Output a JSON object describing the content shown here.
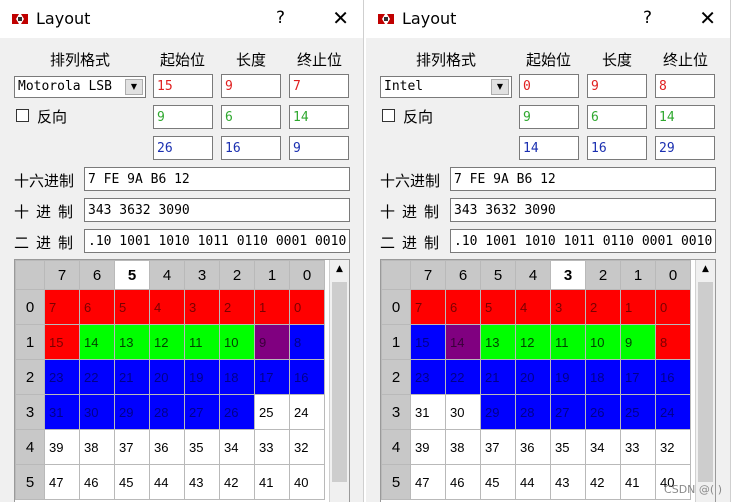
{
  "windows": [
    {
      "title": "Layout",
      "help": "?",
      "close": "✕",
      "headers": {
        "format": "排列格式",
        "start": "起始位",
        "length": "长度",
        "end": "终止位"
      },
      "format_value": "Motorola LSB",
      "reverse_label": "反向",
      "rows": [
        {
          "start": "15",
          "length": "9",
          "end": "7",
          "color": "red"
        },
        {
          "start": "9",
          "length": "6",
          "end": "14",
          "color": "green"
        },
        {
          "start": "26",
          "length": "16",
          "end": "9",
          "color": "blue"
        }
      ],
      "hex_label": "十六进制",
      "hex_value": "7 FE 9A B6 12",
      "dec_label": "十进制",
      "dec_value": "343 3632 3090",
      "bin_label": "二进制",
      "bin_value": ".10 1001 1010 1011 0110 0001 0010",
      "grid": {
        "col_headers": [
          "7",
          "6",
          "5",
          "4",
          "3",
          "2",
          "1",
          "0"
        ],
        "current_col": 2,
        "rows": [
          {
            "label": "0",
            "cells": [
              {
                "v": "7",
                "c": "r"
              },
              {
                "v": "6",
                "c": "r"
              },
              {
                "v": "5",
                "c": "r"
              },
              {
                "v": "4",
                "c": "r"
              },
              {
                "v": "3",
                "c": "r"
              },
              {
                "v": "2",
                "c": "r"
              },
              {
                "v": "1",
                "c": "r"
              },
              {
                "v": "0",
                "c": "r"
              }
            ]
          },
          {
            "label": "1",
            "cells": [
              {
                "v": "15",
                "c": "r"
              },
              {
                "v": "14",
                "c": "g"
              },
              {
                "v": "13",
                "c": "g"
              },
              {
                "v": "12",
                "c": "g"
              },
              {
                "v": "11",
                "c": "g"
              },
              {
                "v": "10",
                "c": "g"
              },
              {
                "v": "9",
                "c": "p"
              },
              {
                "v": "8",
                "c": "b"
              }
            ]
          },
          {
            "label": "2",
            "cells": [
              {
                "v": "23",
                "c": "b"
              },
              {
                "v": "22",
                "c": "b"
              },
              {
                "v": "21",
                "c": "b"
              },
              {
                "v": "20",
                "c": "b"
              },
              {
                "v": "19",
                "c": "b"
              },
              {
                "v": "18",
                "c": "b"
              },
              {
                "v": "17",
                "c": "b"
              },
              {
                "v": "16",
                "c": "b"
              }
            ]
          },
          {
            "label": "3",
            "cells": [
              {
                "v": "31",
                "c": "b"
              },
              {
                "v": "30",
                "c": "b"
              },
              {
                "v": "29",
                "c": "b"
              },
              {
                "v": "28",
                "c": "b"
              },
              {
                "v": "27",
                "c": "b"
              },
              {
                "v": "26",
                "c": "b"
              },
              {
                "v": "25",
                "c": "w"
              },
              {
                "v": "24",
                "c": "w"
              }
            ]
          },
          {
            "label": "4",
            "cells": [
              {
                "v": "39",
                "c": "w"
              },
              {
                "v": "38",
                "c": "w"
              },
              {
                "v": "37",
                "c": "w"
              },
              {
                "v": "36",
                "c": "w"
              },
              {
                "v": "35",
                "c": "w"
              },
              {
                "v": "34",
                "c": "w"
              },
              {
                "v": "33",
                "c": "w"
              },
              {
                "v": "32",
                "c": "w"
              }
            ]
          },
          {
            "label": "5",
            "cells": [
              {
                "v": "47",
                "c": "w"
              },
              {
                "v": "46",
                "c": "w"
              },
              {
                "v": "45",
                "c": "w"
              },
              {
                "v": "44",
                "c": "w"
              },
              {
                "v": "43",
                "c": "w"
              },
              {
                "v": "42",
                "c": "w"
              },
              {
                "v": "41",
                "c": "w"
              },
              {
                "v": "40",
                "c": "w"
              }
            ]
          }
        ]
      }
    },
    {
      "title": "Layout",
      "help": "?",
      "close": "✕",
      "headers": {
        "format": "排列格式",
        "start": "起始位",
        "length": "长度",
        "end": "终止位"
      },
      "format_value": "Intel",
      "reverse_label": "反向",
      "rows": [
        {
          "start": "0",
          "length": "9",
          "end": "8",
          "color": "red"
        },
        {
          "start": "9",
          "length": "6",
          "end": "14",
          "color": "green"
        },
        {
          "start": "14",
          "length": "16",
          "end": "29",
          "color": "blue"
        }
      ],
      "hex_label": "十六进制",
      "hex_value": "7 FE 9A B6 12",
      "dec_label": "十进制",
      "dec_value": "343 3632 3090",
      "bin_label": "二进制",
      "bin_value": ".10 1001 1010 1011 0110 0001 0010",
      "grid": {
        "col_headers": [
          "7",
          "6",
          "5",
          "4",
          "3",
          "2",
          "1",
          "0"
        ],
        "current_col": 4,
        "rows": [
          {
            "label": "0",
            "cells": [
              {
                "v": "7",
                "c": "r"
              },
              {
                "v": "6",
                "c": "r"
              },
              {
                "v": "5",
                "c": "r"
              },
              {
                "v": "4",
                "c": "r"
              },
              {
                "v": "3",
                "c": "r"
              },
              {
                "v": "2",
                "c": "r"
              },
              {
                "v": "1",
                "c": "r"
              },
              {
                "v": "0",
                "c": "r"
              }
            ]
          },
          {
            "label": "1",
            "cells": [
              {
                "v": "15",
                "c": "b"
              },
              {
                "v": "14",
                "c": "p"
              },
              {
                "v": "13",
                "c": "g"
              },
              {
                "v": "12",
                "c": "g"
              },
              {
                "v": "11",
                "c": "g"
              },
              {
                "v": "10",
                "c": "g"
              },
              {
                "v": "9",
                "c": "g"
              },
              {
                "v": "8",
                "c": "r"
              }
            ]
          },
          {
            "label": "2",
            "cells": [
              {
                "v": "23",
                "c": "b"
              },
              {
                "v": "22",
                "c": "b"
              },
              {
                "v": "21",
                "c": "b"
              },
              {
                "v": "20",
                "c": "b"
              },
              {
                "v": "19",
                "c": "b"
              },
              {
                "v": "18",
                "c": "b"
              },
              {
                "v": "17",
                "c": "b"
              },
              {
                "v": "16",
                "c": "b"
              }
            ]
          },
          {
            "label": "3",
            "cells": [
              {
                "v": "31",
                "c": "w"
              },
              {
                "v": "30",
                "c": "w"
              },
              {
                "v": "29",
                "c": "b"
              },
              {
                "v": "28",
                "c": "b"
              },
              {
                "v": "27",
                "c": "b"
              },
              {
                "v": "26",
                "c": "b"
              },
              {
                "v": "25",
                "c": "b"
              },
              {
                "v": "24",
                "c": "b"
              }
            ]
          },
          {
            "label": "4",
            "cells": [
              {
                "v": "39",
                "c": "w"
              },
              {
                "v": "38",
                "c": "w"
              },
              {
                "v": "37",
                "c": "w"
              },
              {
                "v": "36",
                "c": "w"
              },
              {
                "v": "35",
                "c": "w"
              },
              {
                "v": "34",
                "c": "w"
              },
              {
                "v": "33",
                "c": "w"
              },
              {
                "v": "32",
                "c": "w"
              }
            ]
          },
          {
            "label": "5",
            "cells": [
              {
                "v": "47",
                "c": "w"
              },
              {
                "v": "46",
                "c": "w"
              },
              {
                "v": "45",
                "c": "w"
              },
              {
                "v": "44",
                "c": "w"
              },
              {
                "v": "43",
                "c": "w"
              },
              {
                "v": "42",
                "c": "w"
              },
              {
                "v": "41",
                "c": "w"
              },
              {
                "v": "40",
                "c": "w"
              }
            ]
          }
        ]
      }
    }
  ],
  "watermark": "CSDN @( )",
  "colors": {
    "red": "#ff0000",
    "green": "#00ff00",
    "blue": "#0000ff",
    "purple": "#800080"
  }
}
